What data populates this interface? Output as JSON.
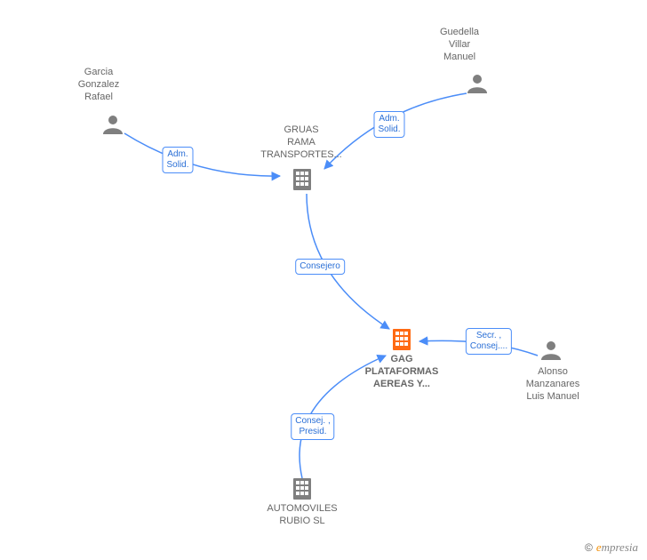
{
  "colors": {
    "link": "#4b8df8",
    "icon_grey": "#7f7f7f",
    "icon_highlight": "#ff6a13",
    "text_grey": "#666666"
  },
  "nodes": {
    "garcia": {
      "label": "Garcia\nGonzalez\nRafael"
    },
    "guedella": {
      "label": "Guedella\nVillar\nManuel"
    },
    "alonso": {
      "label": "Alonso\nManzanares\nLuis Manuel"
    },
    "gruas": {
      "label": "GRUAS\nRAMA\nTRANSPORTES..."
    },
    "gag": {
      "label": "GAG\nPLATAFORMAS\nAEREAS Y..."
    },
    "autos": {
      "label": "AUTOMOVILES\nRUBIO  SL"
    }
  },
  "edges": {
    "garcia_gruas": {
      "label": "Adm.\nSolid."
    },
    "guedella_gruas": {
      "label": "Adm.\nSolid."
    },
    "gruas_gag": {
      "label": "Consejero"
    },
    "alonso_gag": {
      "label": "Secr. ,\nConsej...."
    },
    "autos_gag": {
      "label": "Consej. ,\nPresid."
    }
  },
  "watermark": {
    "copy": "©",
    "e": "e",
    "rest": "mpresia"
  }
}
